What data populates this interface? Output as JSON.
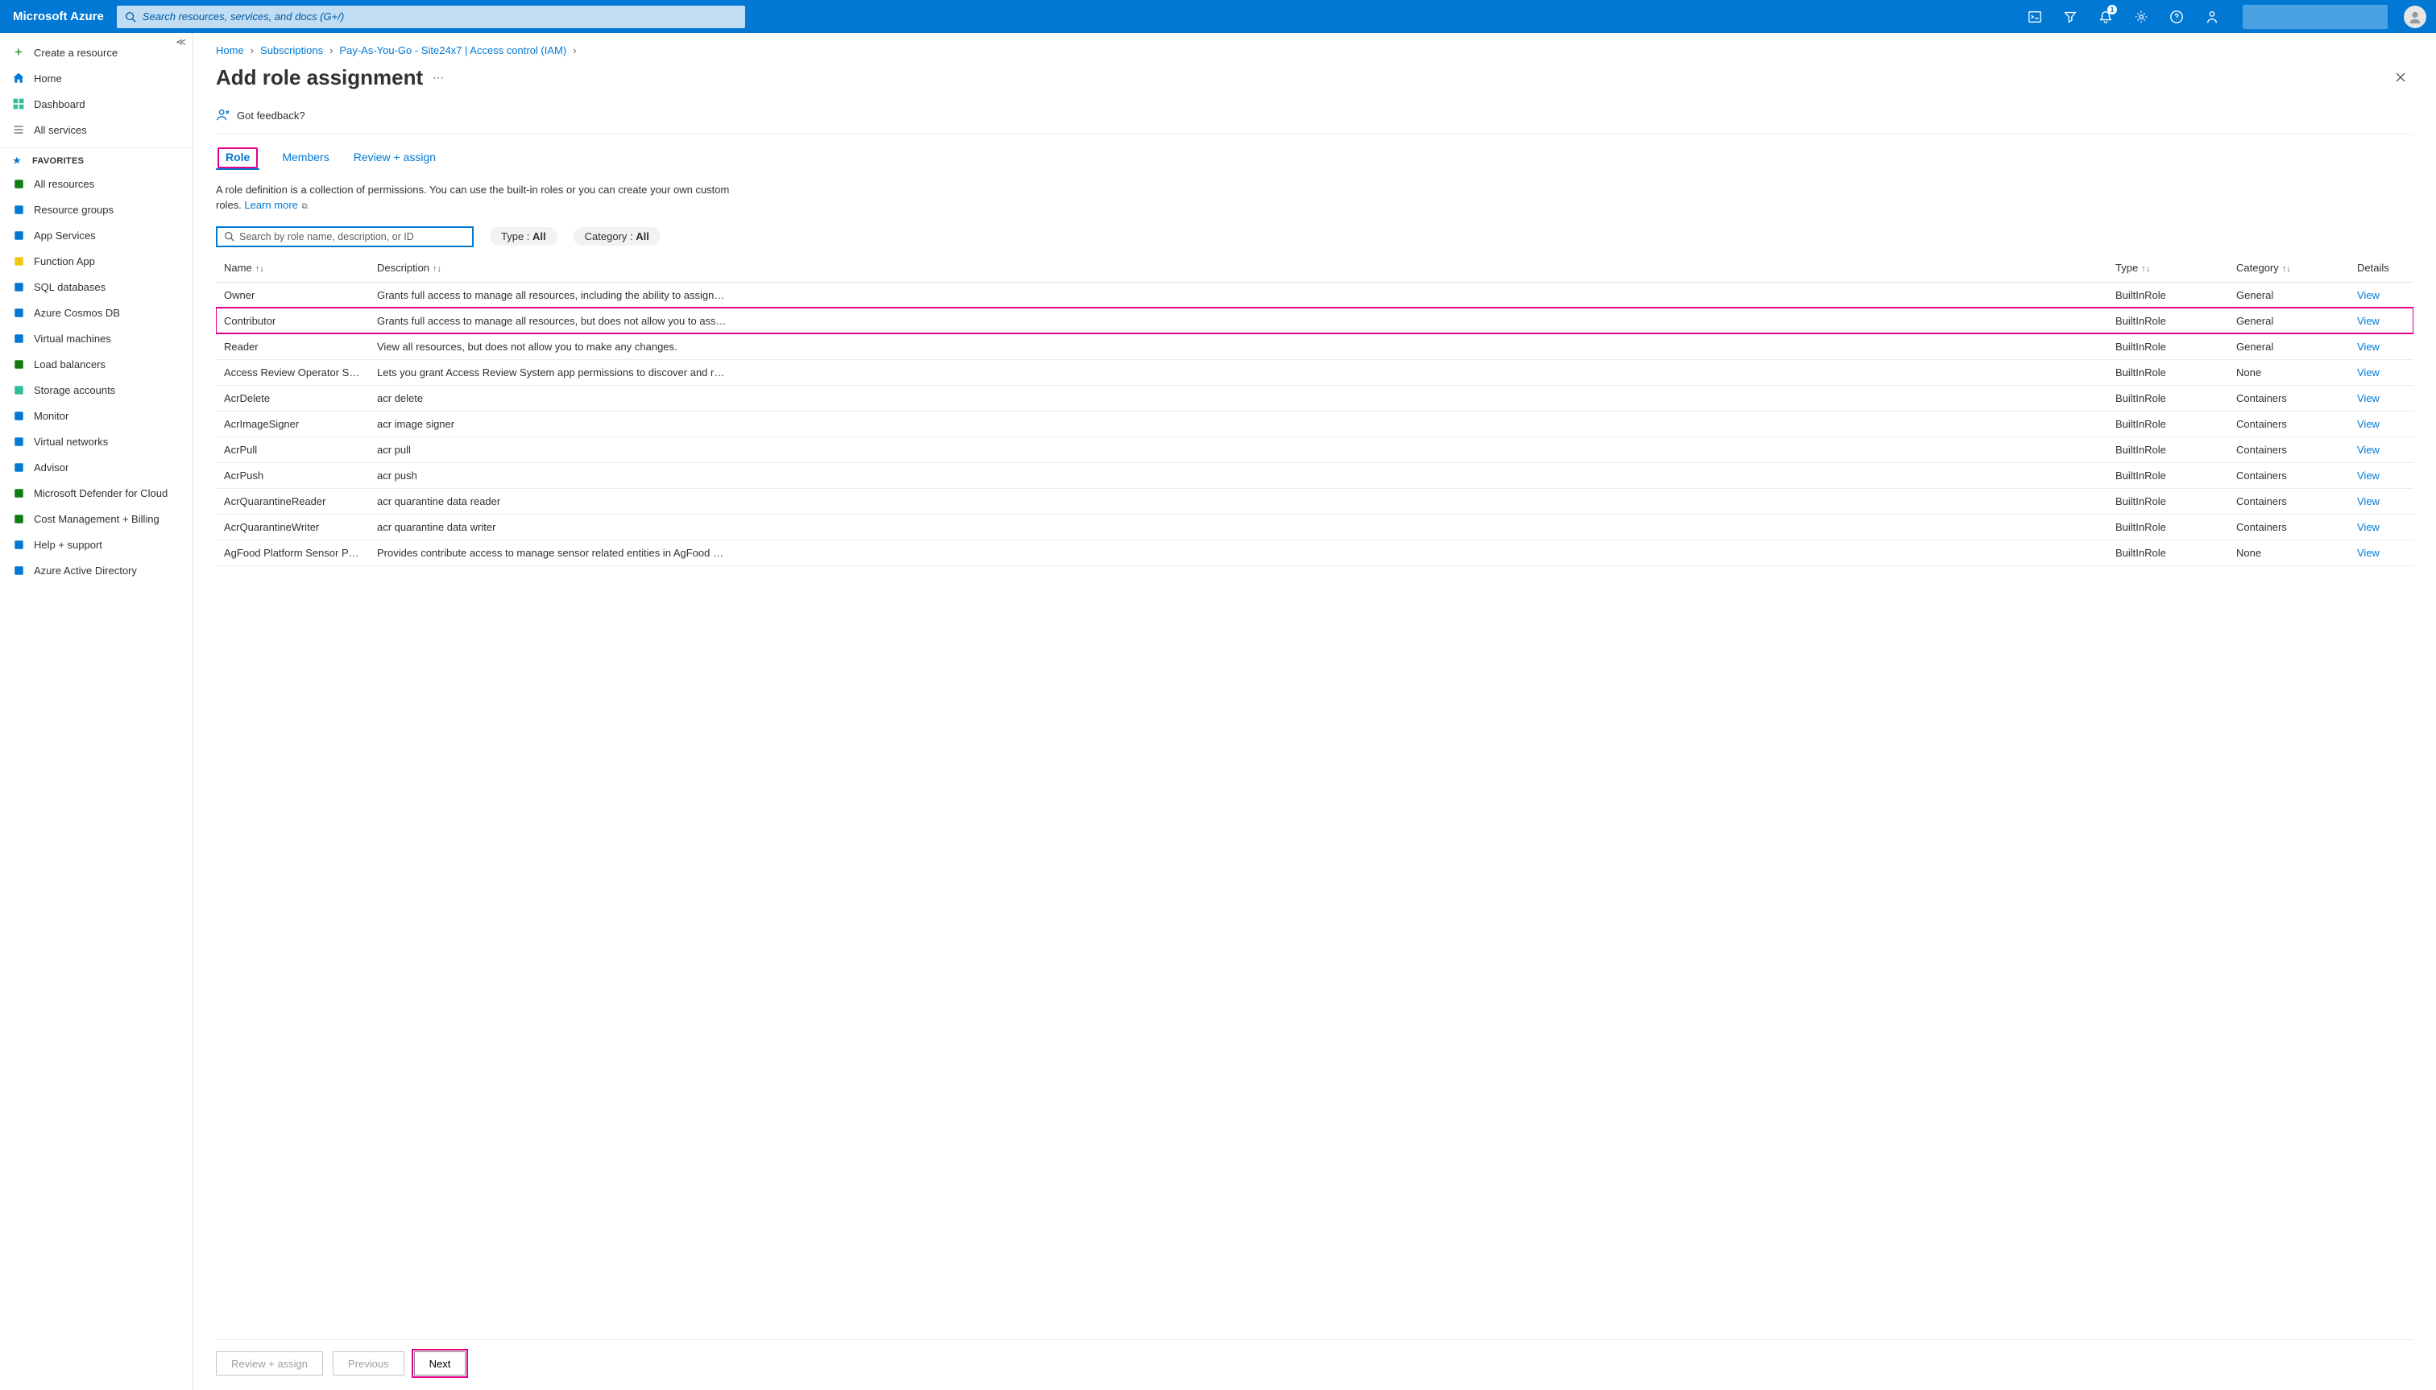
{
  "brand": "Microsoft Azure",
  "search": {
    "placeholder": "Search resources, services, and docs (G+/)"
  },
  "notifications": {
    "count": "1"
  },
  "sidebar": {
    "top": [
      {
        "label": "Create a resource",
        "icon": "plus"
      },
      {
        "label": "Home",
        "icon": "home"
      },
      {
        "label": "Dashboard",
        "icon": "dashboard"
      },
      {
        "label": "All services",
        "icon": "list"
      }
    ],
    "fav_header": "FAVORITES",
    "favorites": [
      {
        "label": "All resources",
        "color": "#107c10"
      },
      {
        "label": "Resource groups",
        "color": "#0078d4"
      },
      {
        "label": "App Services",
        "color": "#0078d4"
      },
      {
        "label": "Function App",
        "color": "#f2c811"
      },
      {
        "label": "SQL databases",
        "color": "#0078d4"
      },
      {
        "label": "Azure Cosmos DB",
        "color": "#0078d4"
      },
      {
        "label": "Virtual machines",
        "color": "#0078d4"
      },
      {
        "label": "Load balancers",
        "color": "#107c10"
      },
      {
        "label": "Storage accounts",
        "color": "#32be9a"
      },
      {
        "label": "Monitor",
        "color": "#0078d4"
      },
      {
        "label": "Virtual networks",
        "color": "#0078d4"
      },
      {
        "label": "Advisor",
        "color": "#0078d4"
      },
      {
        "label": "Microsoft Defender for Cloud",
        "color": "#107c10"
      },
      {
        "label": "Cost Management + Billing",
        "color": "#107c10"
      },
      {
        "label": "Help + support",
        "color": "#0078d4"
      },
      {
        "label": "Azure Active Directory",
        "color": "#0078d4"
      }
    ]
  },
  "breadcrumb": [
    {
      "label": "Home"
    },
    {
      "label": "Subscriptions"
    },
    {
      "label": "Pay-As-You-Go - Site24x7 | Access control (IAM)"
    }
  ],
  "page_title": "Add role assignment",
  "feedback": "Got feedback?",
  "tabs": [
    {
      "label": "Role",
      "active": true,
      "highlight": true
    },
    {
      "label": "Members"
    },
    {
      "label": "Review + assign"
    }
  ],
  "helptext": {
    "line1": "A role definition is a collection of permissions. You can use the built-in roles or you can create your own custom roles. ",
    "learn": "Learn more"
  },
  "role_search": {
    "placeholder": "Search by role name, description, or ID"
  },
  "filters": {
    "type_label": "Type : ",
    "type_value": "All",
    "cat_label": "Category : ",
    "cat_value": "All"
  },
  "columns": {
    "name": "Name",
    "desc": "Description",
    "type": "Type",
    "cat": "Category",
    "details": "Details"
  },
  "view_label": "View",
  "rows": [
    {
      "name": "Owner",
      "desc": "Grants full access to manage all resources, including the ability to assign…",
      "type": "BuiltInRole",
      "cat": "General"
    },
    {
      "name": "Contributor",
      "desc": "Grants full access to manage all resources, but does not allow you to ass…",
      "type": "BuiltInRole",
      "cat": "General",
      "highlight": true
    },
    {
      "name": "Reader",
      "desc": "View all resources, but does not allow you to make any changes.",
      "type": "BuiltInRole",
      "cat": "General"
    },
    {
      "name": "Access Review Operator Ser…",
      "desc": "Lets you grant Access Review System app permissions to discover and r…",
      "type": "BuiltInRole",
      "cat": "None"
    },
    {
      "name": "AcrDelete",
      "desc": "acr delete",
      "type": "BuiltInRole",
      "cat": "Containers"
    },
    {
      "name": "AcrImageSigner",
      "desc": "acr image signer",
      "type": "BuiltInRole",
      "cat": "Containers"
    },
    {
      "name": "AcrPull",
      "desc": "acr pull",
      "type": "BuiltInRole",
      "cat": "Containers"
    },
    {
      "name": "AcrPush",
      "desc": "acr push",
      "type": "BuiltInRole",
      "cat": "Containers"
    },
    {
      "name": "AcrQuarantineReader",
      "desc": "acr quarantine data reader",
      "type": "BuiltInRole",
      "cat": "Containers"
    },
    {
      "name": "AcrQuarantineWriter",
      "desc": "acr quarantine data writer",
      "type": "BuiltInRole",
      "cat": "Containers"
    },
    {
      "name": "AgFood Platform Sensor Pa…",
      "desc": "Provides contribute access to manage sensor related entities in AgFood …",
      "type": "BuiltInRole",
      "cat": "None"
    }
  ],
  "buttons": {
    "review": "Review + assign",
    "prev": "Previous",
    "next": "Next"
  }
}
